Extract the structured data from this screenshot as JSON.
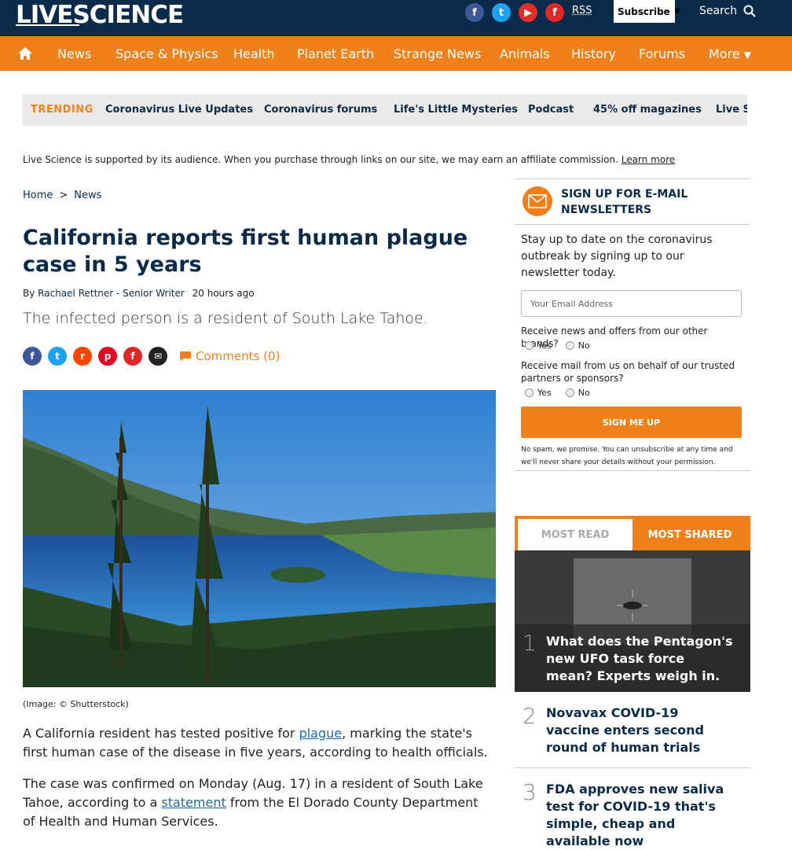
{
  "header": {
    "logo": "LIVESCIENCE",
    "rss": "RSS",
    "subscribe": "Subscribe",
    "search": "Search",
    "social": [
      "facebook-icon",
      "twitter-icon",
      "youtube-icon",
      "flipboard-icon"
    ]
  },
  "nav": {
    "items": [
      "News",
      "Space & Physics",
      "Health",
      "Planet Earth",
      "Strange News",
      "Animals",
      "History",
      "Forums",
      "More"
    ]
  },
  "trending": {
    "label": "TRENDING",
    "items": [
      "Coronavirus Live Updates",
      "Coronavirus forums",
      "Life's Little Mysteries",
      "Podcast",
      "45% off magazines",
      "Live Sc"
    ]
  },
  "affiliate": {
    "text": "Live Science is supported by its audience. When you purchase through links on our site, we may earn an affiliate commission.",
    "link": "Learn more"
  },
  "breadcrumb": {
    "home": "Home",
    "sep": ">",
    "section": "News"
  },
  "article": {
    "title": "California reports first human plague case in 5 years",
    "by": "By",
    "author": "Rachael Rettner - Senior Writer",
    "time": "20 hours ago",
    "dek": "The infected person is a resident of South Lake Tahoe.",
    "comments": "Comments (0)",
    "caption": "(Image: © Shutterstock)",
    "p1_a": "A California resident has tested positive for ",
    "p1_link": "plague",
    "p1_b": ", marking the state's first human case of the disease in five years, according to health officials.",
    "p2_a": "The case was confirmed on Monday (Aug. 17) in a resident of South Lake Tahoe, according to a ",
    "p2_link": "statement",
    "p2_b": " from the El Dorado County Department of Health and Human Services."
  },
  "newsletter": {
    "title": "SIGN UP FOR E-MAIL NEWSLETTERS",
    "desc": "Stay up to date on the coronavirus outbreak by signing up to our newsletter today.",
    "email_placeholder": "Your Email Address",
    "q1": "Receive news and offers from our other brands?",
    "q2": "Receive mail from us on behalf of our trusted partners or sponsors?",
    "yes": "Yes",
    "no": "No",
    "button": "SIGN ME UP",
    "fine": "No spam, we promise. You can unsubscribe at any time and we'll never share your details without your permission."
  },
  "most": {
    "tab_read": "MOST READ",
    "tab_shared": "MOST SHARED",
    "items": [
      {
        "num": "1",
        "title": "What does the Pentagon's new UFO task force mean? Experts weigh in."
      },
      {
        "num": "2",
        "title": "Novavax COVID-19 vaccine enters second round of human trials"
      },
      {
        "num": "3",
        "title": "FDA approves new saliva test for COVID-19 that's simple, cheap and available now"
      }
    ]
  },
  "colors": {
    "navy": "#0a2a4a",
    "orange": "#f0801a"
  }
}
